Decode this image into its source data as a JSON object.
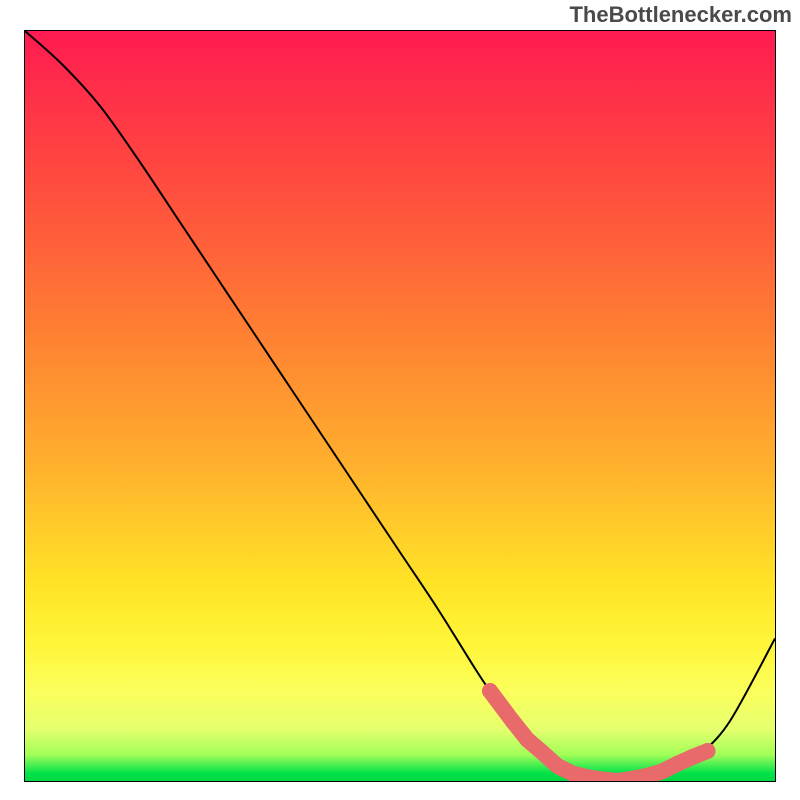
{
  "watermark": "TheBottlenecker.com",
  "chart_data": {
    "type": "line",
    "title": "",
    "xlabel": "",
    "ylabel": "",
    "xlim": [
      0,
      100
    ],
    "ylim": [
      0,
      100
    ],
    "series": [
      {
        "name": "curve",
        "x": [
          0,
          5,
          10,
          15,
          20,
          25,
          30,
          35,
          40,
          45,
          50,
          55,
          60,
          62,
          65,
          68,
          72,
          76,
          80,
          84,
          88,
          90,
          94,
          100
        ],
        "y": [
          100,
          95.5,
          90,
          83,
          75.5,
          68,
          60.5,
          53,
          45.5,
          38,
          30.5,
          23,
          15,
          12,
          8,
          5,
          2,
          0.5,
          0,
          0.5,
          2,
          3.5,
          8,
          19
        ],
        "color": "#000000",
        "width": 2
      },
      {
        "name": "markers",
        "x": [
          62,
          65,
          67,
          69,
          71,
          73,
          75,
          77,
          79,
          81,
          83,
          85,
          87,
          89,
          91
        ],
        "y": [
          12,
          8,
          5.5,
          3.8,
          2,
          1,
          0.5,
          0.2,
          0,
          0.3,
          0.7,
          1.3,
          2.3,
          3.2,
          4
        ],
        "color": "#e86a6a",
        "marker_size": 8
      }
    ],
    "background_gradient": {
      "top": "#ff1a51",
      "mid": "#ffe426",
      "bottom": "#00d843"
    }
  }
}
